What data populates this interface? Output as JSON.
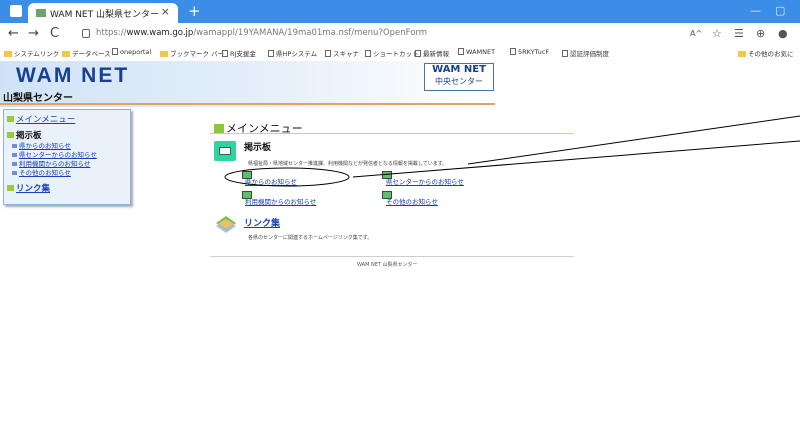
{
  "browser": {
    "tab_title": "WAM NET 山梨県センター",
    "tab_close": "×",
    "new_tab": "+",
    "window_controls": {
      "minimize": "—",
      "restore": "▢"
    },
    "url_prefix": "https://",
    "url_domain": "www.wam.go.jp",
    "url_path": "/wamappl/19YAMANA/19ma01ma.nsf/menu?OpenForm",
    "reader_label": "A^",
    "nav": {
      "back": "←",
      "forward": "→",
      "refresh": "C",
      "home": "⌂"
    }
  },
  "favorites": [
    {
      "label": "システムリンク",
      "type": "folder"
    },
    {
      "label": "データベース",
      "type": "folder"
    },
    {
      "label": "oneportal",
      "type": "page"
    },
    {
      "label": "ブックマーク バー",
      "type": "folder"
    },
    {
      "label": "RJ支援金",
      "type": "page"
    },
    {
      "label": "県HPシステム",
      "type": "page"
    },
    {
      "label": "スキャナ",
      "type": "page"
    },
    {
      "label": "ショートカット",
      "type": "page"
    },
    {
      "label": "最新情報",
      "type": "page"
    },
    {
      "label": "WAMNET",
      "type": "page"
    },
    {
      "label": "5RKYTucF",
      "type": "page"
    },
    {
      "label": "認証評価制度",
      "type": "page"
    }
  ],
  "favorites_other": "その他のお気に",
  "site": {
    "logo": "WAM NET",
    "center_logo_line1": "WAM NET",
    "center_logo_line2": "中央センター",
    "prefecture_title": "山梨県センター"
  },
  "sidebar": {
    "main_menu": "メインメニュー",
    "bulletin": "掲示板",
    "sub_items": [
      "県からのお知らせ",
      "県センターからのお知らせ",
      "利用機関からのお知らせ",
      "その他のお知らせ"
    ],
    "links": "リンク集"
  },
  "main": {
    "title": "メインメニュー",
    "bulletin_title": "掲示板",
    "bulletin_desc": "県福祉局・県地域センター推進課、利用機関などが発信者となる情報を掲載しています。",
    "bulletin_links": [
      "県からのお知らせ",
      "県センターからのお知らせ",
      "利用機関からのお知らせ",
      "その他のお知らせ"
    ],
    "links_title": "リンク集",
    "links_desc": "各県のセンターに関連するホームページリンク集です。",
    "footer": "WAM NET 山梨県センター"
  },
  "colors": {
    "titlebar": "#3c8de6",
    "link": "#1a3fb3",
    "accent_green": "#8cc63f",
    "orange_rule": "#e3a360",
    "annotation": "#000000"
  }
}
